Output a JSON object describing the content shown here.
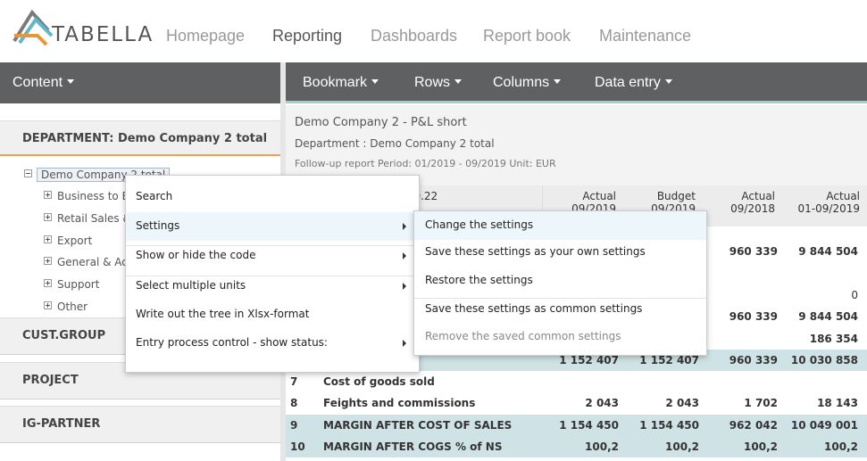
{
  "brand": {
    "name": "TABELLA",
    "colors": {
      "orange": "#e8963c",
      "teal": "#5fb8c9",
      "gray": "#7a7a7a"
    }
  },
  "nav": {
    "items": [
      "Homepage",
      "Reporting",
      "Dashboards",
      "Report book",
      "Maintenance"
    ],
    "active": "Reporting"
  },
  "left": {
    "content_menu": "Content",
    "sections": [
      "DEPARTMENT: Demo Company 2 total",
      "CUST.GROUP",
      "PROJECT",
      "IG-PARTNER"
    ],
    "tree": {
      "root": "Demo Company 2 total",
      "children": [
        "Business to B",
        "Retail Sales &",
        "Export",
        "General & Ad",
        "Support",
        "Other"
      ]
    }
  },
  "toolbar": {
    "bookmark": "Bookmark",
    "rows": "Rows",
    "columns": "Columns",
    "data_entry": "Data entry"
  },
  "report": {
    "title": "Demo Company 2 - P&L short",
    "department": "Department : Demo Company 2 total",
    "followup": "Follow-up report Period: 01/2019 - 09/2019 Unit: EUR"
  },
  "table": {
    "corner_label": ".10.22",
    "columns": [
      {
        "line1": "Actual",
        "line2": "09/2019"
      },
      {
        "line1": "Budget",
        "line2": "09/2019"
      },
      {
        "line1": "Actual",
        "line2": "09/2018"
      },
      {
        "line1": "Actual",
        "line2": "01-09/2019"
      }
    ],
    "partial_rows": [
      {
        "c3": "960 339",
        "c4": "9 844 504"
      },
      {
        "c3": "",
        "c4": "0"
      },
      {
        "c3": "960 339",
        "c4": "9 844 504"
      },
      {
        "c3": "",
        "c4": "186 354"
      },
      {
        "c1": "1 152 407",
        "c2": "1 152 407",
        "c3": "960 339",
        "c4": "10 030 858"
      }
    ],
    "rows": [
      {
        "no": "7",
        "name": "Cost of goods sold",
        "c1": "",
        "c2": "",
        "c3": "",
        "c4": ""
      },
      {
        "no": "8",
        "name": "Feights and commissions",
        "c1": "2 043",
        "c2": "2 043",
        "c3": "1 702",
        "c4": "18 143"
      },
      {
        "no": "9",
        "name": "MARGIN AFTER COST OF SALES",
        "c1": "1 154 450",
        "c2": "1 154 450",
        "c3": "962 042",
        "c4": "10 049 001"
      },
      {
        "no": "10",
        "name": "MARGIN AFTER COGS % of NS",
        "c1": "100,2",
        "c2": "100,2",
        "c3": "100,2",
        "c4": "100,2"
      }
    ]
  },
  "context_menu": {
    "items": [
      "Search",
      "Settings",
      "Show or hide the code",
      "Select multiple units",
      "Write out the tree in Xlsx-format",
      "Entry process control - show status:"
    ]
  },
  "submenu": {
    "items": [
      "Change the settings",
      "Save these settings as your own settings",
      "Restore the settings",
      "Save these settings as common settings",
      "Remove the saved common settings"
    ]
  }
}
